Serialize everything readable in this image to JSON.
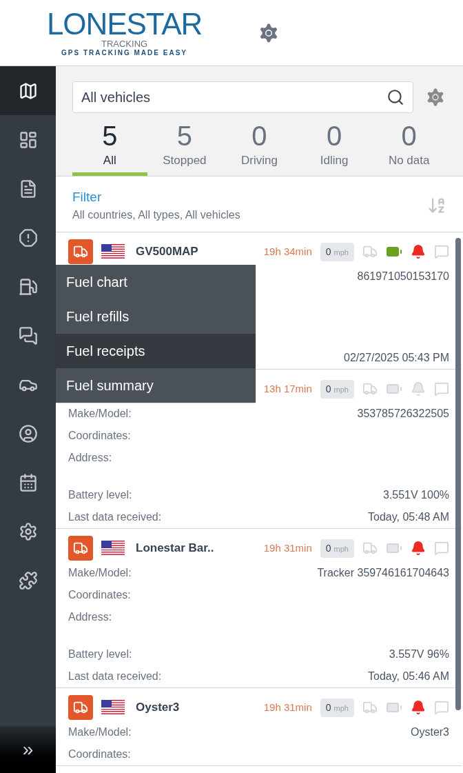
{
  "logo": {
    "name": "LONESTAR",
    "sub": "TRACKING",
    "tagline": "GPS TRACKING MADE EASY"
  },
  "sidebar": {
    "items": [
      {
        "selected": true
      },
      {
        "selected": false
      },
      {
        "selected": false
      },
      {
        "selected": false
      },
      {
        "selected": false
      },
      {
        "selected": false
      },
      {
        "selected": false
      },
      {
        "selected": false
      },
      {
        "selected": false
      },
      {
        "selected": false
      },
      {
        "selected": false
      }
    ],
    "expand": "»"
  },
  "search": {
    "value": "All vehicles"
  },
  "tabs": [
    {
      "count": "5",
      "label": "All",
      "selected": true
    },
    {
      "count": "5",
      "label": "Stopped",
      "selected": false
    },
    {
      "count": "0",
      "label": "Driving",
      "selected": false
    },
    {
      "count": "0",
      "label": "Idling",
      "selected": false
    },
    {
      "count": "0",
      "label": "No data",
      "selected": false
    }
  ],
  "filter": {
    "title": "Filter",
    "summary": "All countries, All types, All vehicles"
  },
  "vehicles": [
    {
      "name": "GV500MAP",
      "duration": "19h 34min",
      "speed": "0",
      "unit": "mph",
      "battery_ok": true,
      "alarm": true,
      "rows": [
        {
          "value": "861971050153170"
        },
        {},
        {},
        {},
        {
          "value": "02/27/2025 05:43 PM"
        }
      ]
    },
    {
      "duration": "13h 17min",
      "speed": "0",
      "unit": "mph",
      "battery_ok": false,
      "alarm": false,
      "rows": [
        {
          "label": "Make/Model:",
          "value": "353785726322505"
        },
        {
          "label": "Coordinates:"
        },
        {
          "label": "Address:"
        },
        {},
        {
          "label": "Battery level:",
          "value": "3.551V 100%"
        },
        {
          "label": "Last data received:",
          "value": "Today, 05:48 AM"
        }
      ]
    },
    {
      "name": "Lonestar Bar..",
      "duration": "19h 31min",
      "speed": "0",
      "unit": "mph",
      "battery_ok": false,
      "alarm": true,
      "rows": [
        {
          "label": "Make/Model:",
          "value": "Tracker 359746161704643"
        },
        {
          "label": "Coordinates:"
        },
        {
          "label": "Address:"
        },
        {},
        {
          "label": "Battery level:",
          "value": "3.557V 96%"
        },
        {
          "label": "Last data received:",
          "value": "Today, 05:46 AM"
        }
      ]
    },
    {
      "name": "Oyster3",
      "duration": "19h 31min",
      "speed": "0",
      "unit": "mph",
      "battery_ok": false,
      "alarm": true,
      "rows": [
        {
          "label": "Make/Model:",
          "value": "Oyster3"
        },
        {
          "label": "Coordinates:"
        }
      ]
    }
  ],
  "fuel_menu": {
    "items": [
      {
        "label": "Fuel chart",
        "selected": false
      },
      {
        "label": "Fuel refills",
        "selected": false
      },
      {
        "label": "Fuel receipts",
        "selected": true
      },
      {
        "label": "Fuel summary",
        "selected": false
      }
    ]
  }
}
